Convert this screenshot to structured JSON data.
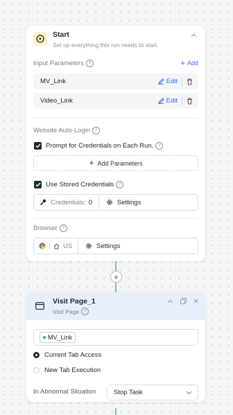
{
  "start": {
    "title": "Start",
    "subtitle": "Set up everything this run needs to start.",
    "input_parameters_label": "Input Parameters",
    "add_label": "Add",
    "params": [
      {
        "name": "MV_Link",
        "edit": "Edit"
      },
      {
        "name": "Video_Link",
        "edit": "Edit"
      }
    ],
    "auto_login_label": "Website Auto-Login",
    "prompt_credentials_label": "Prompt for Credentials on Each Run.",
    "add_parameters_label": "Add Parameters",
    "stored_credentials_label": "Use Stored Credentials",
    "credentials_label": "Credentials:",
    "credentials_count": "0",
    "settings_label": "Settings",
    "browser_label": "Browser",
    "browser_region": "US",
    "browser_settings_label": "Settings"
  },
  "visit": {
    "title": "Visit Page_1",
    "subtitle": "Visit Page",
    "url_chip": "MV_Link",
    "current_tab_label": "Current Tab Access",
    "new_tab_label": "New Tab Execution",
    "abnormal_label": "In Abnormal Situation",
    "abnormal_value": "Stop Task"
  },
  "colors": {
    "accent": "#2e6be6",
    "connector": "#69d09a",
    "header_bg": "#e7effc",
    "start_icon_bg": "#fdf2c4"
  }
}
